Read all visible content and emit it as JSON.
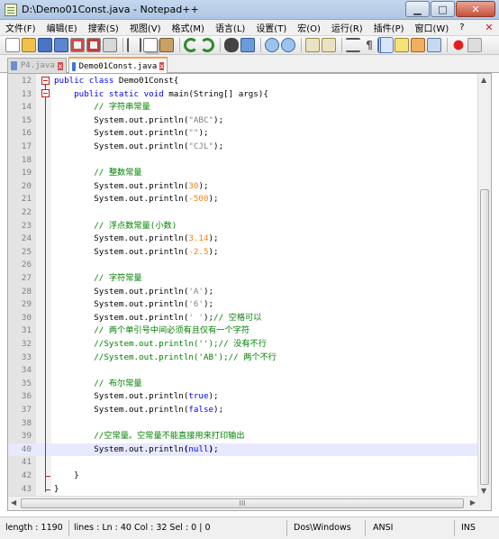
{
  "window": {
    "title": "D:\\Demo01Const.java - Notepad++"
  },
  "menu": [
    "文件(F)",
    "编辑(E)",
    "搜索(S)",
    "视图(V)",
    "格式(M)",
    "语言(L)",
    "设置(T)",
    "宏(O)",
    "运行(R)",
    "插件(P)",
    "窗口(W)",
    "?"
  ],
  "tabs": [
    {
      "label": "P4.java",
      "active": false
    },
    {
      "label": "Demo01Const.java",
      "active": true
    }
  ],
  "editor": {
    "current_line": 40,
    "lines": [
      {
        "n": "12",
        "parts": [
          [
            "kw",
            "public class "
          ],
          [
            "pl",
            "Demo01Const{"
          ]
        ]
      },
      {
        "n": "13",
        "parts": [
          [
            "pl",
            "    "
          ],
          [
            "kw",
            "public static void "
          ],
          [
            "pl",
            "main(String[] args){"
          ]
        ]
      },
      {
        "n": "14",
        "parts": [
          [
            "pl",
            "        "
          ],
          [
            "cm",
            "// 字符串常量"
          ]
        ]
      },
      {
        "n": "15",
        "parts": [
          [
            "pl",
            "        System.out.println("
          ],
          [
            "str",
            "\"ABC\""
          ],
          [
            "pl",
            ");"
          ]
        ]
      },
      {
        "n": "16",
        "parts": [
          [
            "pl",
            "        System.out.println("
          ],
          [
            "str",
            "\"\""
          ],
          [
            "pl",
            ");"
          ]
        ]
      },
      {
        "n": "17",
        "parts": [
          [
            "pl",
            "        System.out.println("
          ],
          [
            "str",
            "\"CJL\""
          ],
          [
            "pl",
            ");"
          ]
        ]
      },
      {
        "n": "18",
        "parts": []
      },
      {
        "n": "19",
        "parts": [
          [
            "pl",
            "        "
          ],
          [
            "cm",
            "// 整数常量"
          ]
        ]
      },
      {
        "n": "20",
        "parts": [
          [
            "pl",
            "        System.out.println("
          ],
          [
            "num",
            "30"
          ],
          [
            "pl",
            ");"
          ]
        ]
      },
      {
        "n": "21",
        "parts": [
          [
            "pl",
            "        System.out.println("
          ],
          [
            "num",
            "-500"
          ],
          [
            "pl",
            ");"
          ]
        ]
      },
      {
        "n": "22",
        "parts": []
      },
      {
        "n": "23",
        "parts": [
          [
            "pl",
            "        "
          ],
          [
            "cm",
            "// 浮点数常量(小数)"
          ]
        ]
      },
      {
        "n": "24",
        "parts": [
          [
            "pl",
            "        System.out.println("
          ],
          [
            "num",
            "3.14"
          ],
          [
            "pl",
            ");"
          ]
        ]
      },
      {
        "n": "25",
        "parts": [
          [
            "pl",
            "        System.out.println("
          ],
          [
            "num",
            "-2.5"
          ],
          [
            "pl",
            ");"
          ]
        ]
      },
      {
        "n": "26",
        "parts": []
      },
      {
        "n": "27",
        "parts": [
          [
            "pl",
            "        "
          ],
          [
            "cm",
            "// 字符常量"
          ]
        ]
      },
      {
        "n": "28",
        "parts": [
          [
            "pl",
            "        System.out.println("
          ],
          [
            "str",
            "'A'"
          ],
          [
            "pl",
            ");"
          ]
        ]
      },
      {
        "n": "29",
        "parts": [
          [
            "pl",
            "        System.out.println("
          ],
          [
            "str",
            "'6'"
          ],
          [
            "pl",
            ");"
          ]
        ]
      },
      {
        "n": "30",
        "parts": [
          [
            "pl",
            "        System.out.println("
          ],
          [
            "str",
            "' '"
          ],
          [
            "pl",
            ");"
          ],
          [
            "cm",
            "// 空格可以"
          ]
        ]
      },
      {
        "n": "31",
        "parts": [
          [
            "pl",
            "        "
          ],
          [
            "cm",
            "// 两个单引号中间必须有且仅有一个字符"
          ]
        ]
      },
      {
        "n": "32",
        "parts": [
          [
            "pl",
            "        "
          ],
          [
            "cm",
            "//System.out.println('');// 没有不行"
          ]
        ]
      },
      {
        "n": "33",
        "parts": [
          [
            "pl",
            "        "
          ],
          [
            "cm",
            "//System.out.println('AB');// 两个不行"
          ]
        ]
      },
      {
        "n": "34",
        "parts": []
      },
      {
        "n": "35",
        "parts": [
          [
            "pl",
            "        "
          ],
          [
            "cm",
            "// 布尔常量"
          ]
        ]
      },
      {
        "n": "36",
        "parts": [
          [
            "pl",
            "        System.out.println("
          ],
          [
            "kw",
            "true"
          ],
          [
            "pl",
            ");"
          ]
        ]
      },
      {
        "n": "37",
        "parts": [
          [
            "pl",
            "        System.out.println("
          ],
          [
            "kw",
            "false"
          ],
          [
            "pl",
            ");"
          ]
        ]
      },
      {
        "n": "38",
        "parts": []
      },
      {
        "n": "39",
        "parts": [
          [
            "pl",
            "        "
          ],
          [
            "cm",
            "//空常量。空常量不能直接用来打印输出"
          ]
        ]
      },
      {
        "n": "40",
        "parts": [
          [
            "pl",
            "        System.out.println"
          ],
          [
            "op",
            "("
          ],
          [
            "kw",
            "null"
          ],
          [
            "op",
            ")"
          ],
          [
            "pl",
            ";"
          ]
        ]
      },
      {
        "n": "41",
        "parts": []
      },
      {
        "n": "42",
        "parts": [
          [
            "pl",
            "    }"
          ]
        ]
      },
      {
        "n": "43",
        "parts": [
          [
            "pl",
            "}"
          ]
        ]
      }
    ]
  },
  "statusbar": {
    "length": "length : 1190",
    "position": "lines : Ln : 40    Col : 32    Sel : 0 | 0",
    "eol": "Dos\\Windows",
    "encoding": "ANSI",
    "mode": "INS"
  }
}
